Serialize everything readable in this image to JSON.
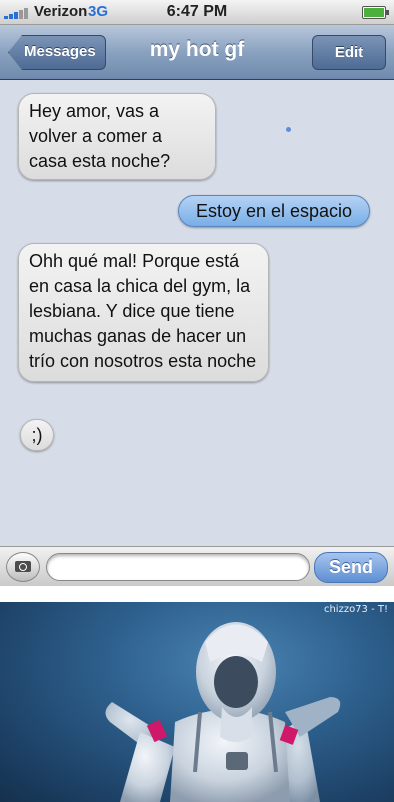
{
  "status_bar": {
    "carrier": "Verizon",
    "network": "3G",
    "time": "6:47 PM",
    "battery_level": 1.0
  },
  "nav": {
    "back_label": "Messages",
    "title": "my hot gf",
    "edit_label": "Edit"
  },
  "messages": [
    {
      "direction": "incoming",
      "text": "Hey amor, vas a volver a comer a casa esta noche?"
    },
    {
      "direction": "outgoing",
      "text": "Estoy en el espacio"
    },
    {
      "direction": "incoming",
      "text": "Ohh qué mal! Porque está en casa la chica del gym, la lesbiana. Y dice que tiene muchas ganas de hacer un trío con nosotros esta noche"
    },
    {
      "direction": "incoming",
      "text": ";)"
    }
  ],
  "input_bar": {
    "camera_icon": "camera-icon",
    "field_value": "",
    "send_label": "Send"
  },
  "photo": {
    "credit": "chizzo73 - T!"
  },
  "colors": {
    "background": "#d7dde8",
    "outgoing_bubble": "#8bbcf0",
    "incoming_bubble": "#e8e8e8",
    "nav_bar": "#8aa2c0"
  }
}
